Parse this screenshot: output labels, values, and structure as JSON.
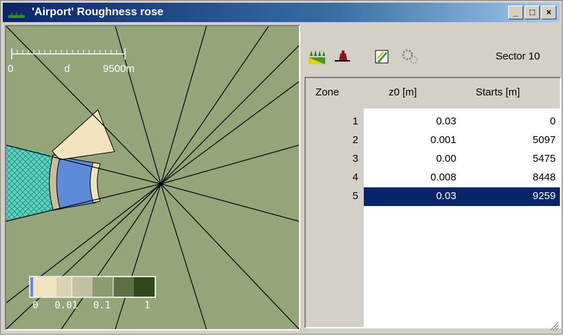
{
  "window": {
    "title": "'Airport' Roughness rose",
    "minimize_glyph": "_",
    "maximize_glyph": "□",
    "close_glyph": "×"
  },
  "scale_bar": {
    "start_label": "0",
    "mid_label": "d",
    "end_label": "9500m"
  },
  "legend": {
    "labels": [
      "0",
      "0.01",
      "0.1",
      "1"
    ],
    "colors": [
      "#f3e4c0",
      "#dbd2b0",
      "#b6b894",
      "#8e9a70",
      "#5e7044",
      "#2e4a1c"
    ]
  },
  "colors": {
    "rose_background": "#94a57a",
    "zone_water_blue": "#5d8ad9",
    "zone_cream": "#f3e4c0",
    "zone_hatch": "#40e0d0",
    "selection": "#0a246a"
  },
  "toolbar": {
    "icons": [
      "roughness-map-icon",
      "obstacle-icon",
      "edit-icon",
      "settings-gear-icon"
    ]
  },
  "sector_label": "Sector 10",
  "table": {
    "headers": [
      "Zone",
      "z0 [m]",
      "Starts [m]"
    ],
    "rows": [
      {
        "zone": "1",
        "z0": "0.03",
        "starts": "0"
      },
      {
        "zone": "2",
        "z0": "0.001",
        "starts": "5097"
      },
      {
        "zone": "3",
        "z0": "0.00",
        "starts": "5475"
      },
      {
        "zone": "4",
        "z0": "0.008",
        "starts": "8448"
      },
      {
        "zone": "5",
        "z0": "0.03",
        "starts": "9259"
      }
    ],
    "selected_row": 4
  }
}
